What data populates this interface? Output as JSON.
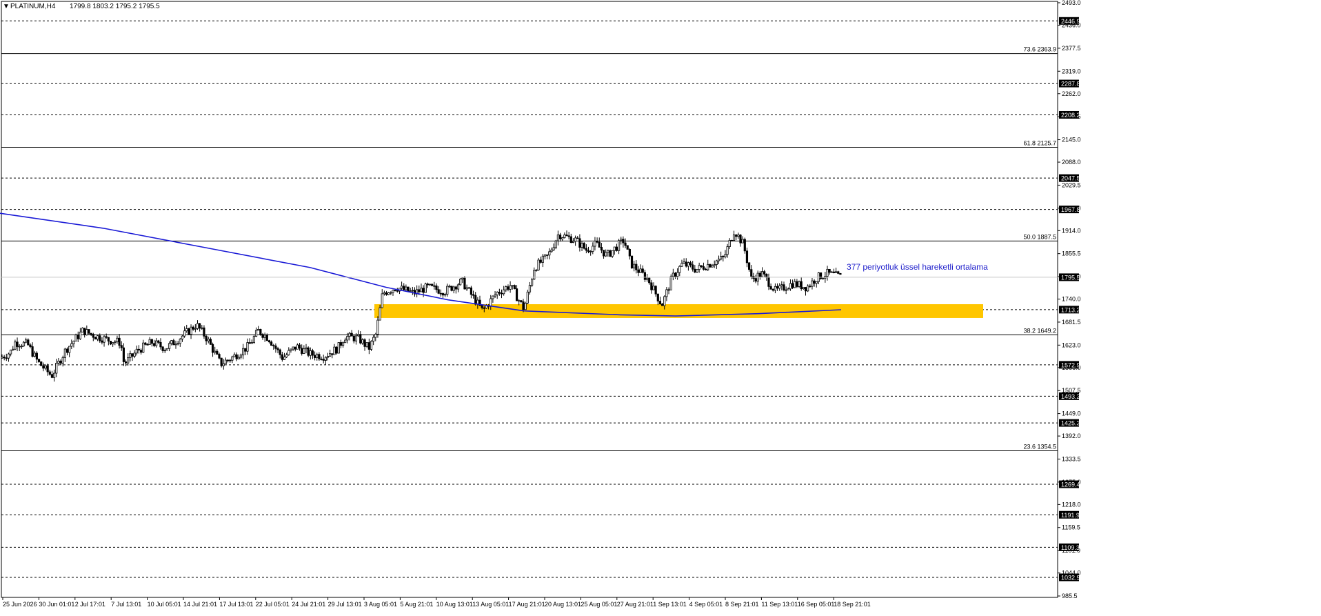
{
  "header": {
    "symbol": "PLATINUM,H4",
    "ohlc": "1799.8 1803.2 1795.2 1795.5"
  },
  "colors": {
    "background": "#ffffff",
    "candle": "#000000",
    "ema": "#1a1ad6",
    "zone": "#ffc600",
    "annotation": "#2222cc",
    "badge": "#000000"
  },
  "annotation": "377 periyotluk üssel hareketli ortalama",
  "chart_data": {
    "type": "candlestick",
    "ylim": [
      960,
      2500
    ],
    "y_ticks": [
      "2493.0",
      "2436.0",
      "2377.5",
      "2319.0",
      "2262.0",
      "2203.5",
      "2145.0",
      "2088.0",
      "2029.5",
      "1971.0",
      "1914.0",
      "1855.5",
      "1797.0",
      "1740.0",
      "1681.5",
      "1623.0",
      "1566.0",
      "1507.5",
      "1449.0",
      "1392.0",
      "1333.5",
      "1275.0",
      "1218.0",
      "1159.5",
      "1101.0",
      "1044.0",
      "985.5"
    ],
    "x_ticks": [
      "25 Jun 2026",
      "30 Jun 01:01",
      "2 Jul 17:01",
      "7 Jul 13:01",
      "10 Jul 05:01",
      "14 Jul 21:01",
      "17 Jul 13:01",
      "22 Jul 05:01",
      "24 Jul 21:01",
      "29 Jul 13:01",
      "3 Aug 05:01",
      "5 Aug 21:01",
      "10 Aug 13:01",
      "13 Aug 05:01",
      "17 Aug 21:01",
      "20 Aug 13:01",
      "25 Aug 05:01",
      "27 Aug 21:01",
      "1 Sep 13:01",
      "4 Sep 05:01",
      "8 Sep 21:01",
      "11 Sep 13:01",
      "16 Sep 05:01",
      "18 Sep 21:01"
    ],
    "levels": [
      "2446.9",
      "2287.8",
      "2208.2",
      "2047.5",
      "1967.8",
      "1713.2",
      "1572.9",
      "1493.2",
      "1425.3",
      "1269.4",
      "1191.9",
      "1109.3",
      "1032.9"
    ],
    "fib_levels": [
      {
        "label": "73.6 2363.9",
        "value": 2363.9
      },
      {
        "label": "61.8 2125.7",
        "value": 2125.7
      },
      {
        "label": "50.0 1887.5",
        "value": 1887.5
      },
      {
        "label": "38.2 1649.2",
        "value": 1649.2
      },
      {
        "label": "23.6 1354.5",
        "value": 1354.5
      }
    ],
    "current_price": "1795.5",
    "zone": {
      "low": 1692,
      "high": 1727
    },
    "path_anchors": [
      {
        "x": 0,
        "p": 1590
      },
      {
        "x": 15,
        "p": 1605
      },
      {
        "x": 22,
        "p": 1630
      },
      {
        "x": 40,
        "p": 1625
      },
      {
        "x": 55,
        "p": 1580
      },
      {
        "x": 75,
        "p": 1545
      },
      {
        "x": 95,
        "p": 1610
      },
      {
        "x": 110,
        "p": 1640
      },
      {
        "x": 120,
        "p": 1660
      },
      {
        "x": 140,
        "p": 1645
      },
      {
        "x": 160,
        "p": 1635
      },
      {
        "x": 175,
        "p": 1630
      },
      {
        "x": 180,
        "p": 1575
      },
      {
        "x": 200,
        "p": 1610
      },
      {
        "x": 220,
        "p": 1630
      },
      {
        "x": 240,
        "p": 1615
      },
      {
        "x": 260,
        "p": 1640
      },
      {
        "x": 285,
        "p": 1675
      },
      {
        "x": 300,
        "p": 1640
      },
      {
        "x": 320,
        "p": 1575
      },
      {
        "x": 340,
        "p": 1595
      },
      {
        "x": 360,
        "p": 1620
      },
      {
        "x": 375,
        "p": 1660
      },
      {
        "x": 390,
        "p": 1640
      },
      {
        "x": 410,
        "p": 1590
      },
      {
        "x": 430,
        "p": 1620
      },
      {
        "x": 450,
        "p": 1600
      },
      {
        "x": 470,
        "p": 1595
      },
      {
        "x": 490,
        "p": 1615
      },
      {
        "x": 500,
        "p": 1645
      },
      {
        "x": 520,
        "p": 1640
      },
      {
        "x": 535,
        "p": 1615
      },
      {
        "x": 545,
        "p": 1650
      },
      {
        "x": 555,
        "p": 1755
      },
      {
        "x": 575,
        "p": 1770
      },
      {
        "x": 600,
        "p": 1755
      },
      {
        "x": 620,
        "p": 1770
      },
      {
        "x": 645,
        "p": 1760
      },
      {
        "x": 670,
        "p": 1785
      },
      {
        "x": 700,
        "p": 1710
      },
      {
        "x": 720,
        "p": 1755
      },
      {
        "x": 740,
        "p": 1775
      },
      {
        "x": 760,
        "p": 1715
      },
      {
        "x": 775,
        "p": 1820
      },
      {
        "x": 795,
        "p": 1850
      },
      {
        "x": 810,
        "p": 1905
      },
      {
        "x": 835,
        "p": 1890
      },
      {
        "x": 850,
        "p": 1865
      },
      {
        "x": 865,
        "p": 1880
      },
      {
        "x": 880,
        "p": 1850
      },
      {
        "x": 905,
        "p": 1890
      },
      {
        "x": 915,
        "p": 1830
      },
      {
        "x": 940,
        "p": 1790
      },
      {
        "x": 960,
        "p": 1725
      },
      {
        "x": 975,
        "p": 1795
      },
      {
        "x": 990,
        "p": 1830
      },
      {
        "x": 1010,
        "p": 1815
      },
      {
        "x": 1030,
        "p": 1830
      },
      {
        "x": 1050,
        "p": 1845
      },
      {
        "x": 1065,
        "p": 1915
      },
      {
        "x": 1078,
        "p": 1880
      },
      {
        "x": 1090,
        "p": 1790
      },
      {
        "x": 1105,
        "p": 1805
      },
      {
        "x": 1125,
        "p": 1760
      },
      {
        "x": 1150,
        "p": 1780
      },
      {
        "x": 1170,
        "p": 1770
      },
      {
        "x": 1185,
        "p": 1795
      },
      {
        "x": 1200,
        "p": 1805
      },
      {
        "x": 1220,
        "p": 1796
      }
    ],
    "ema_points": [
      {
        "x": 0,
        "p": 1958
      },
      {
        "x": 150,
        "p": 1920
      },
      {
        "x": 300,
        "p": 1870
      },
      {
        "x": 450,
        "p": 1820
      },
      {
        "x": 560,
        "p": 1770
      },
      {
        "x": 650,
        "p": 1738
      },
      {
        "x": 760,
        "p": 1710
      },
      {
        "x": 900,
        "p": 1700
      },
      {
        "x": 980,
        "p": 1697
      },
      {
        "x": 1100,
        "p": 1703
      },
      {
        "x": 1220,
        "p": 1713
      }
    ]
  }
}
